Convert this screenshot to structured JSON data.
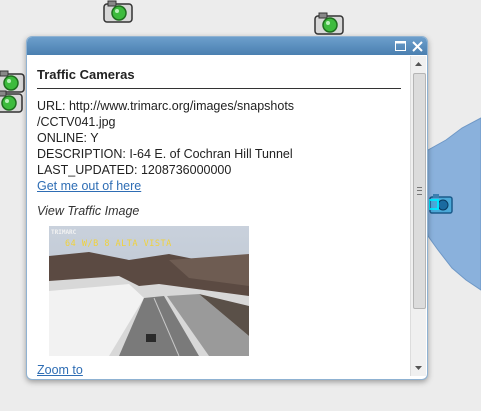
{
  "map": {
    "marker_icon": "traffic-camera-icon",
    "selected_marker_icon": "selected-camera-icon",
    "region_color": "#8ab1dc",
    "marker_light_color": "#3dbb3d"
  },
  "popup": {
    "title": "Traffic Cameras",
    "header_color": "#5a8dbe",
    "maximize_icon": "maximize-icon",
    "close_icon": "close-icon",
    "attributes": {
      "url_line1": "URL: http://www.trimarc.org/images/snapshots",
      "url_line2": "/CCTV041.jpg",
      "online": "ONLINE: Y",
      "description": "DESCRIPTION: I-64 E. of Cochran Hill Tunnel",
      "last_updated": "LAST_UPDATED: 1208736000000"
    },
    "get_out_link": "Get me out of here",
    "image_caption": "View Traffic Image",
    "image_overlay_text": "64 W/B 8   ALTA VISTA",
    "image_logo_text": "TRIMARC",
    "zoom_link": "Zoom to"
  }
}
